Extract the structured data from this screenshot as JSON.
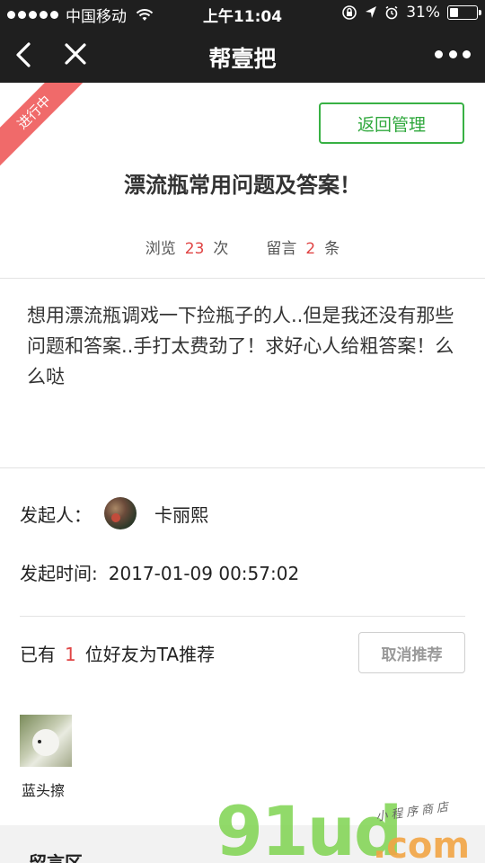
{
  "status_bar": {
    "carrier": "中国移动",
    "time": "上午11:04",
    "battery": "31%",
    "battery_level": 0.31
  },
  "navbar": {
    "title": "帮壹把"
  },
  "post": {
    "ribbon": "进行中",
    "manage_button": "返回管理",
    "title": "漂流瓶常用问题及答案！",
    "views_label": "浏览",
    "views_count": "23",
    "views_unit": "次",
    "comments_label": "留言",
    "comments_count": "2",
    "comments_unit": "条",
    "body": "想用漂流瓶调戏一下捡瓶子的人..但是我还没有那些问题和答案..手打太费劲了！求好心人给粗答案！么么哒"
  },
  "initiator": {
    "label": "发起人：",
    "name": "卡丽熙"
  },
  "start_time": {
    "label": "发起时间:",
    "value": "2017-01-09 00:57:02"
  },
  "recommend": {
    "prefix": "已有",
    "count": "1",
    "suffix": "位好友为TA推荐",
    "button": "取消推荐",
    "friends": [
      {
        "name": "蓝头擦"
      }
    ]
  },
  "comments_section": {
    "title": "留言区"
  },
  "watermark": {
    "main": "91ud",
    "domain": ".com",
    "tagline": "小程序商店"
  },
  "colors": {
    "accent_green": "#38b144",
    "highlight_red": "#e04545",
    "ribbon": "#f06a6a",
    "bar_bg": "#1f1f1f"
  }
}
